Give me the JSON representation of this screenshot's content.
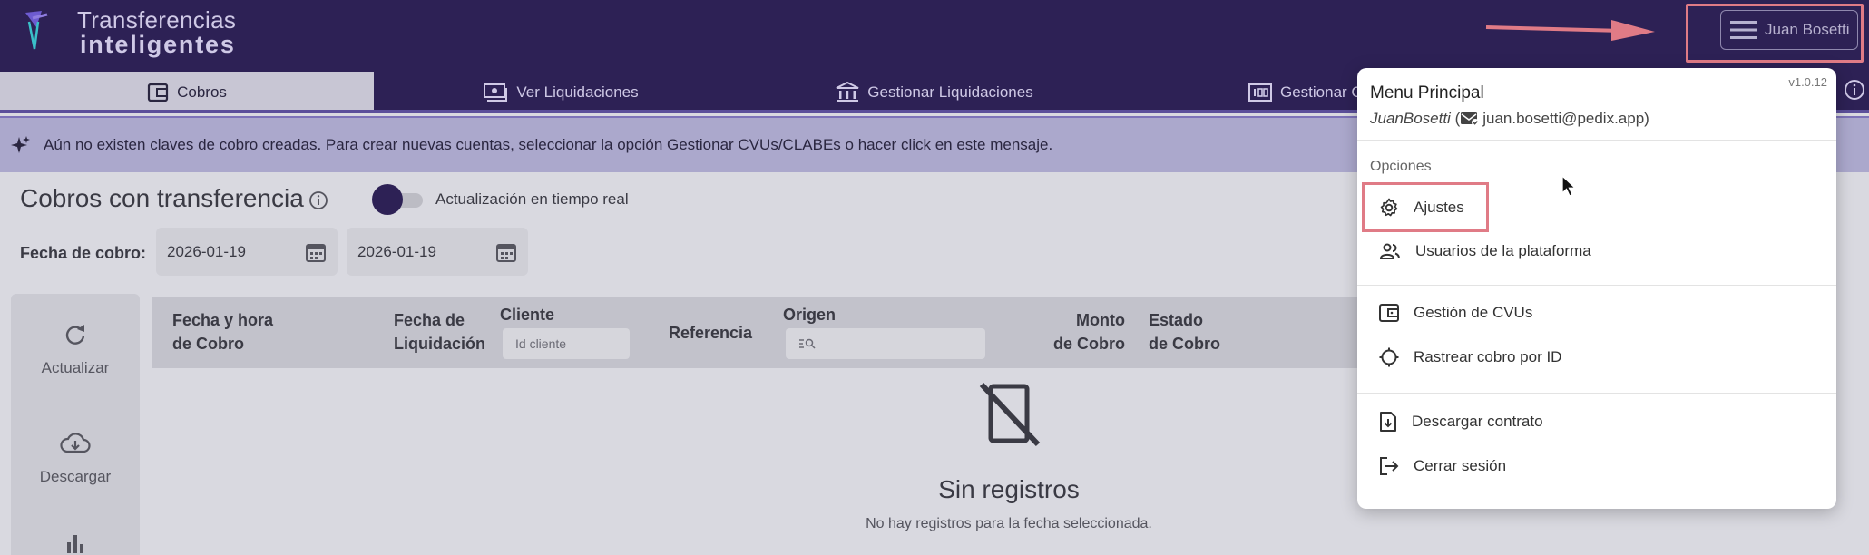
{
  "header": {
    "brand_line1": "Transferencias",
    "brand_line2": "inteligentes",
    "user_button_label": "Juan Bosetti",
    "accent_color": "#2d2155"
  },
  "tabs": [
    {
      "label": "Cobros",
      "icon": "wallet-icon",
      "active": true
    },
    {
      "label": "Ver Liquidaciones",
      "icon": "money-icon"
    },
    {
      "label": "Gestionar Liquidaciones",
      "icon": "bank-icon"
    },
    {
      "label": "Gestionar C",
      "icon": "numbers-icon"
    }
  ],
  "banner": {
    "text": "Aún no existen claves de cobro creadas. Para crear nuevas cuentas, seleccionar la opción Gestionar CVUs/CLABEs o hacer click en este mensaje."
  },
  "page": {
    "title": "Cobros con transferencia",
    "realtime_label": "Actualización en tiempo real",
    "date_label": "Fecha de cobro:",
    "date_from": "2026-01-19",
    "date_to": "2026-01-19"
  },
  "sidebar": {
    "refresh_label": "Actualizar",
    "download_label": "Descargar"
  },
  "table": {
    "col_fecha_hora_1": "Fecha y hora",
    "col_fecha_hora_2": "de Cobro",
    "col_fecha_liq_1": "Fecha de",
    "col_fecha_liq_2": "Liquidación",
    "col_cliente": "Cliente",
    "cliente_placeholder": "Id cliente",
    "col_referencia": "Referencia",
    "col_origen": "Origen",
    "col_monto_1": "Monto",
    "col_monto_2": "de Cobro",
    "col_estado_1": "Estado",
    "col_estado_2": "de Cobro"
  },
  "empty_state": {
    "title": "Sin registros",
    "subtitle": "No hay registros para la fecha seleccionada."
  },
  "menu": {
    "version": "v1.0.12",
    "title": "Menu Principal",
    "username": "JuanBosetti",
    "open_paren": " (",
    "email": "juan.bosetti@pedix.app",
    "close_paren": ")",
    "section_label": "Opciones",
    "items": [
      {
        "label": "Ajustes",
        "icon": "gear-icon"
      },
      {
        "label": "Usuarios de la plataforma",
        "icon": "users-icon"
      },
      {
        "label": "Gestión de CVUs",
        "icon": "wallet-icon"
      },
      {
        "label": "Rastrear cobro por ID",
        "icon": "crosshair-icon"
      },
      {
        "label": "Descargar contrato",
        "icon": "download-file-icon"
      },
      {
        "label": "Cerrar sesión",
        "icon": "logout-icon"
      }
    ]
  },
  "highlight_color": "#e07b86"
}
